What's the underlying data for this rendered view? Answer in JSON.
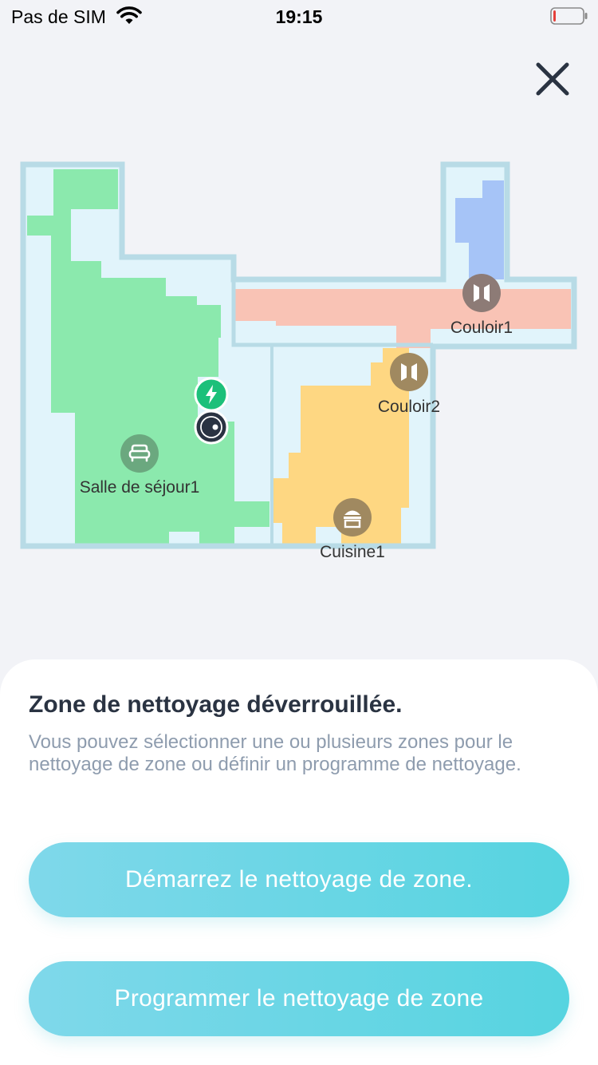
{
  "status_bar": {
    "carrier": "Pas de SIM",
    "time": "19:15",
    "battery_level": 0.08,
    "battery_color": "#e5403b"
  },
  "map": {
    "rooms": [
      {
        "name": "Salle de séjour1",
        "icon": "sofa-icon",
        "color": "#8be9ad",
        "icon_color": "#6ba87f"
      },
      {
        "name": "Couloir1",
        "icon": "door-icon",
        "color": "#f9c3b5",
        "icon_color": "#8d7b76"
      },
      {
        "name": "Couloir2",
        "icon": "door-icon",
        "color": "#fed782",
        "icon_color": "#a08960"
      },
      {
        "name": "Cuisine1",
        "icon": "stove-icon",
        "color": "#fed782",
        "icon_color": "#a08960"
      }
    ],
    "extra_area_color": "#a6c4f7",
    "floor_color": "#e1f4fb",
    "wall_color": "#b8dbe6",
    "dock_icon": "charging-dock-icon",
    "robot_icon": "robot-vacuum-icon"
  },
  "sheet": {
    "title": "Zone de nettoyage déverrouillée.",
    "description": "Vous pouvez sélectionner une ou plusieurs zones pour le nettoyage de zone ou définir un programme de nettoyage.",
    "start_button": "Démarrez le nettoyage de zone.",
    "schedule_button": "Programmer le nettoyage de zone"
  }
}
